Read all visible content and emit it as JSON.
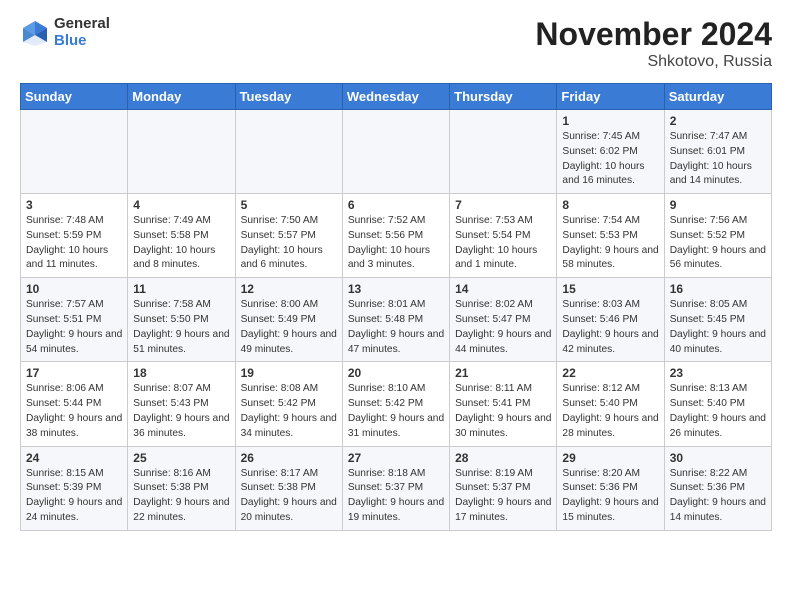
{
  "logo": {
    "general": "General",
    "blue": "Blue"
  },
  "title": "November 2024",
  "subtitle": "Shkotovo, Russia",
  "weekdays": [
    "Sunday",
    "Monday",
    "Tuesday",
    "Wednesday",
    "Thursday",
    "Friday",
    "Saturday"
  ],
  "rows": [
    [
      {
        "day": "",
        "info": ""
      },
      {
        "day": "",
        "info": ""
      },
      {
        "day": "",
        "info": ""
      },
      {
        "day": "",
        "info": ""
      },
      {
        "day": "",
        "info": ""
      },
      {
        "day": "1",
        "info": "Sunrise: 7:45 AM\nSunset: 6:02 PM\nDaylight: 10 hours and 16 minutes."
      },
      {
        "day": "2",
        "info": "Sunrise: 7:47 AM\nSunset: 6:01 PM\nDaylight: 10 hours and 14 minutes."
      }
    ],
    [
      {
        "day": "3",
        "info": "Sunrise: 7:48 AM\nSunset: 5:59 PM\nDaylight: 10 hours and 11 minutes."
      },
      {
        "day": "4",
        "info": "Sunrise: 7:49 AM\nSunset: 5:58 PM\nDaylight: 10 hours and 8 minutes."
      },
      {
        "day": "5",
        "info": "Sunrise: 7:50 AM\nSunset: 5:57 PM\nDaylight: 10 hours and 6 minutes."
      },
      {
        "day": "6",
        "info": "Sunrise: 7:52 AM\nSunset: 5:56 PM\nDaylight: 10 hours and 3 minutes."
      },
      {
        "day": "7",
        "info": "Sunrise: 7:53 AM\nSunset: 5:54 PM\nDaylight: 10 hours and 1 minute."
      },
      {
        "day": "8",
        "info": "Sunrise: 7:54 AM\nSunset: 5:53 PM\nDaylight: 9 hours and 58 minutes."
      },
      {
        "day": "9",
        "info": "Sunrise: 7:56 AM\nSunset: 5:52 PM\nDaylight: 9 hours and 56 minutes."
      }
    ],
    [
      {
        "day": "10",
        "info": "Sunrise: 7:57 AM\nSunset: 5:51 PM\nDaylight: 9 hours and 54 minutes."
      },
      {
        "day": "11",
        "info": "Sunrise: 7:58 AM\nSunset: 5:50 PM\nDaylight: 9 hours and 51 minutes."
      },
      {
        "day": "12",
        "info": "Sunrise: 8:00 AM\nSunset: 5:49 PM\nDaylight: 9 hours and 49 minutes."
      },
      {
        "day": "13",
        "info": "Sunrise: 8:01 AM\nSunset: 5:48 PM\nDaylight: 9 hours and 47 minutes."
      },
      {
        "day": "14",
        "info": "Sunrise: 8:02 AM\nSunset: 5:47 PM\nDaylight: 9 hours and 44 minutes."
      },
      {
        "day": "15",
        "info": "Sunrise: 8:03 AM\nSunset: 5:46 PM\nDaylight: 9 hours and 42 minutes."
      },
      {
        "day": "16",
        "info": "Sunrise: 8:05 AM\nSunset: 5:45 PM\nDaylight: 9 hours and 40 minutes."
      }
    ],
    [
      {
        "day": "17",
        "info": "Sunrise: 8:06 AM\nSunset: 5:44 PM\nDaylight: 9 hours and 38 minutes."
      },
      {
        "day": "18",
        "info": "Sunrise: 8:07 AM\nSunset: 5:43 PM\nDaylight: 9 hours and 36 minutes."
      },
      {
        "day": "19",
        "info": "Sunrise: 8:08 AM\nSunset: 5:42 PM\nDaylight: 9 hours and 34 minutes."
      },
      {
        "day": "20",
        "info": "Sunrise: 8:10 AM\nSunset: 5:42 PM\nDaylight: 9 hours and 31 minutes."
      },
      {
        "day": "21",
        "info": "Sunrise: 8:11 AM\nSunset: 5:41 PM\nDaylight: 9 hours and 30 minutes."
      },
      {
        "day": "22",
        "info": "Sunrise: 8:12 AM\nSunset: 5:40 PM\nDaylight: 9 hours and 28 minutes."
      },
      {
        "day": "23",
        "info": "Sunrise: 8:13 AM\nSunset: 5:40 PM\nDaylight: 9 hours and 26 minutes."
      }
    ],
    [
      {
        "day": "24",
        "info": "Sunrise: 8:15 AM\nSunset: 5:39 PM\nDaylight: 9 hours and 24 minutes."
      },
      {
        "day": "25",
        "info": "Sunrise: 8:16 AM\nSunset: 5:38 PM\nDaylight: 9 hours and 22 minutes."
      },
      {
        "day": "26",
        "info": "Sunrise: 8:17 AM\nSunset: 5:38 PM\nDaylight: 9 hours and 20 minutes."
      },
      {
        "day": "27",
        "info": "Sunrise: 8:18 AM\nSunset: 5:37 PM\nDaylight: 9 hours and 19 minutes."
      },
      {
        "day": "28",
        "info": "Sunrise: 8:19 AM\nSunset: 5:37 PM\nDaylight: 9 hours and 17 minutes."
      },
      {
        "day": "29",
        "info": "Sunrise: 8:20 AM\nSunset: 5:36 PM\nDaylight: 9 hours and 15 minutes."
      },
      {
        "day": "30",
        "info": "Sunrise: 8:22 AM\nSunset: 5:36 PM\nDaylight: 9 hours and 14 minutes."
      }
    ]
  ]
}
